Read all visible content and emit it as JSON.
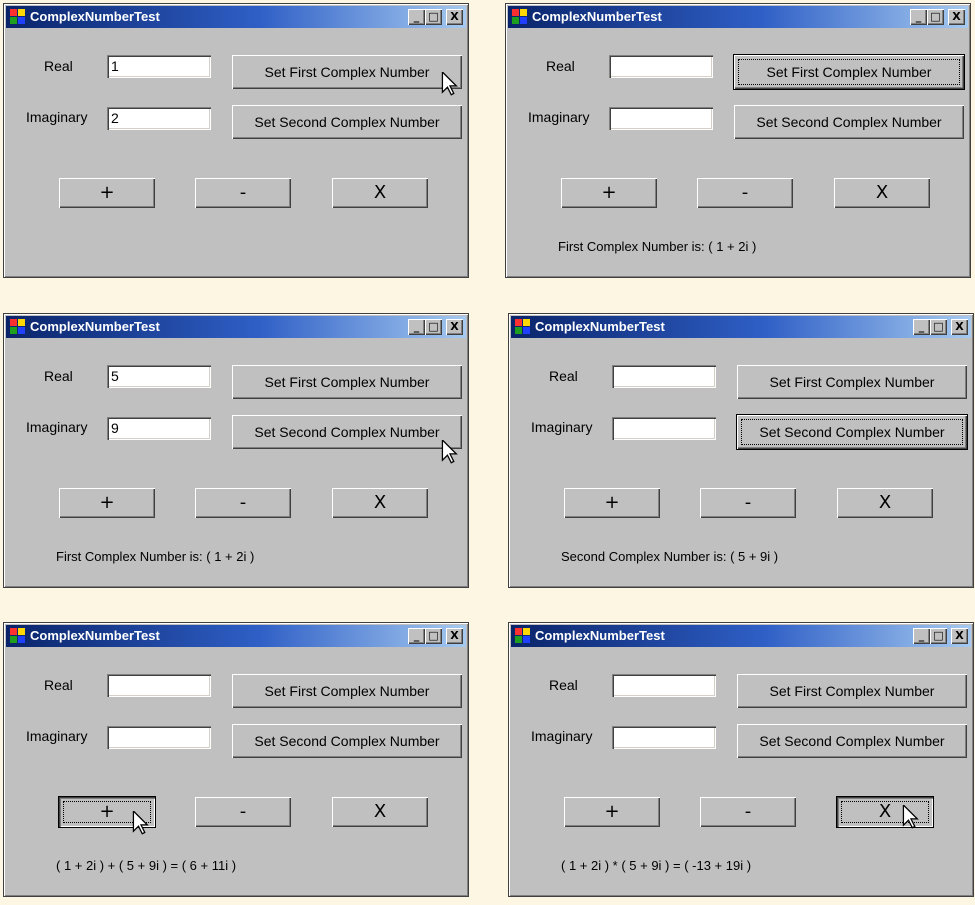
{
  "app": {
    "title": "ComplexNumberTest",
    "real_label": "Real",
    "imaginary_label": "Imaginary",
    "set_first_label": "Set First Complex Number",
    "set_second_label": "Set Second Complex Number",
    "plus_label": "+",
    "minus_label": "-",
    "multiply_label": "X",
    "minimize_glyph": "_",
    "maximize_glyph": "□",
    "close_glyph": "X"
  },
  "windows": [
    {
      "real_value": "1",
      "imaginary_value": "2",
      "status": ""
    },
    {
      "real_value": "",
      "imaginary_value": "",
      "status": "First Complex Number is: ( 1 + 2i )"
    },
    {
      "real_value": "5",
      "imaginary_value": "9",
      "status": "First Complex Number is: ( 1 + 2i )"
    },
    {
      "real_value": "",
      "imaginary_value": "",
      "status": "Second Complex Number is: ( 5 + 9i )"
    },
    {
      "real_value": "",
      "imaginary_value": "",
      "status": "( 1 + 2i ) + ( 5 + 9i ) = ( 6 + 11i )"
    },
    {
      "real_value": "",
      "imaginary_value": "",
      "status": "( 1 + 2i ) * ( 5 + 9i ) = ( -13 + 19i )"
    }
  ]
}
